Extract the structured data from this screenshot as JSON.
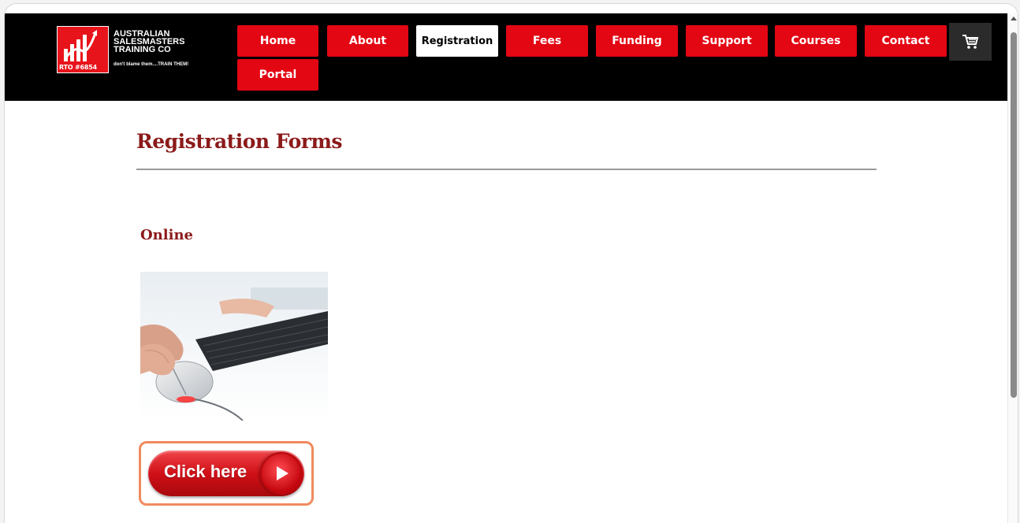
{
  "logo": {
    "name": "AUSTRALIAN\nSALESMASTERS\nTRAINING CO",
    "tagline": "don't blame them....TRAIN THEM!",
    "rto": "RTO #6854"
  },
  "nav": {
    "items": [
      "Home",
      "About",
      "Registration",
      "Fees",
      "Funding",
      "Support",
      "Courses",
      "Contact",
      "Portal"
    ],
    "active": "Registration"
  },
  "page": {
    "title": "Registration Forms",
    "subtitle": "Online",
    "button_label": "Click here"
  },
  "colors": {
    "nav_red": "#e30613",
    "heading": "#8b1a1a",
    "highlight": "#f08a5d"
  },
  "icons": [
    "cart-icon",
    "play-icon",
    "scroll-up-icon"
  ]
}
